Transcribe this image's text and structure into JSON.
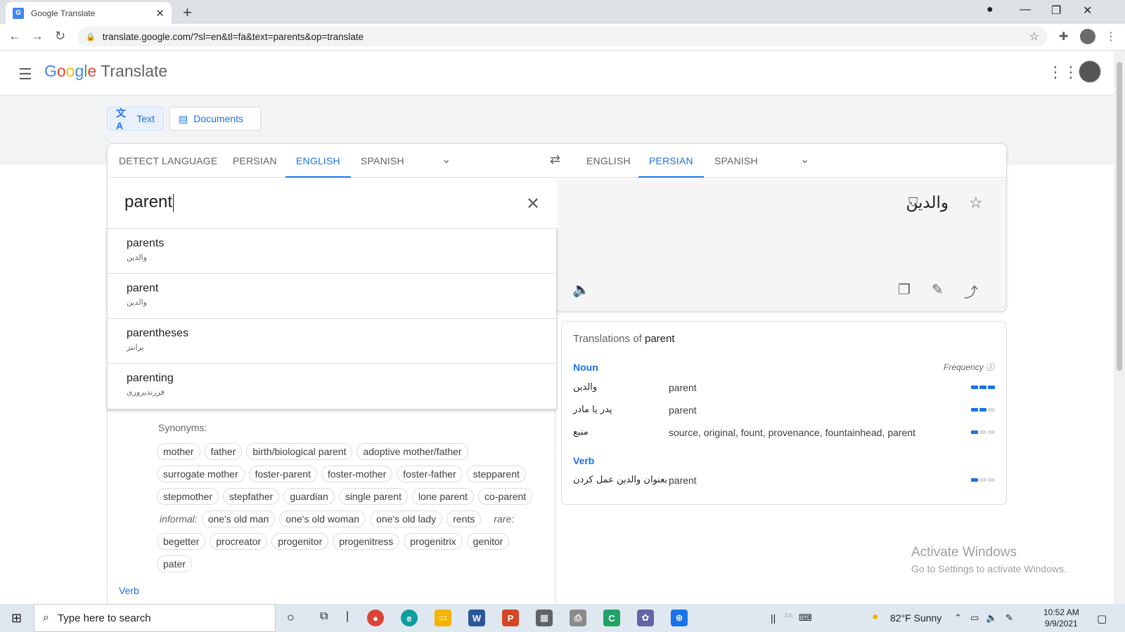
{
  "browser": {
    "tab_title": "Google Translate",
    "tab_favicon": "G",
    "url": "translate.google.com/?sl=en&tl=fa&text=parents&op=translate"
  },
  "header": {
    "logo_letters": [
      "G",
      "o",
      "o",
      "g",
      "l",
      "e"
    ],
    "logo_product": "Translate"
  },
  "modes": {
    "text_label": "Text",
    "documents_label": "Documents"
  },
  "source_langs": [
    "DETECT LANGUAGE",
    "PERSIAN",
    "ENGLISH",
    "SPANISH"
  ],
  "target_langs": [
    "ENGLISH",
    "PERSIAN",
    "SPANISH"
  ],
  "source": {
    "text": "parent"
  },
  "target": {
    "text": "والدین"
  },
  "suggestions": [
    {
      "word": "parents",
      "translation": "والدین"
    },
    {
      "word": "parent",
      "translation": "والدین"
    },
    {
      "word": "parentheses",
      "translation": "پرانتز"
    },
    {
      "word": "parenting",
      "translation": "فرزندپروری"
    }
  ],
  "synonyms": {
    "label": "Synonyms:",
    "rows": [
      [
        "mother",
        "father",
        "birth/biological parent",
        "adoptive mother/father"
      ],
      [
        "surrogate mother",
        "foster-parent",
        "foster-mother",
        "foster-father",
        "stepparent"
      ],
      [
        "stepmother",
        "stepfather",
        "guardian",
        "single parent",
        "lone parent",
        "co-parent"
      ],
      [
        "one's old man",
        "one's old woman",
        "one's old lady",
        "rents"
      ],
      [
        "begetter",
        "procreator",
        "progenitor",
        "progenitress",
        "progenitrix",
        "genitor"
      ],
      [
        "pater"
      ]
    ],
    "informal_label": "informal:",
    "rare_label": "rare:",
    "verb_heading": "Verb"
  },
  "translations": {
    "title_prefix": "Translations of",
    "title_word": "parent",
    "frequency_label": "Frequency",
    "noun_heading": "Noun",
    "verb_heading": "Verb",
    "noun_rows": [
      {
        "fa": "والدین",
        "en": "parent",
        "freq": 3
      },
      {
        "fa": "پدر یا مادر",
        "en": "parent",
        "freq": 2
      },
      {
        "fa": "منبع",
        "en": "source, original, fount, provenance, fountainhead, parent",
        "freq": 1
      }
    ],
    "verb_rows": [
      {
        "fa": "بعنوان والدین عمل کردن",
        "en": "parent",
        "freq": 1
      }
    ]
  },
  "watermark": {
    "line1": "Activate Windows",
    "line2": "Go to Settings to activate Windows."
  },
  "taskbar": {
    "search_placeholder": "Type here to search",
    "weather": "82°F  Sunny",
    "lang_indicator": "FA",
    "time": "10:52 AM",
    "date": "9/9/2021"
  },
  "colors": {
    "accent": "#1a73e8",
    "bar_off": "#dadce0"
  }
}
